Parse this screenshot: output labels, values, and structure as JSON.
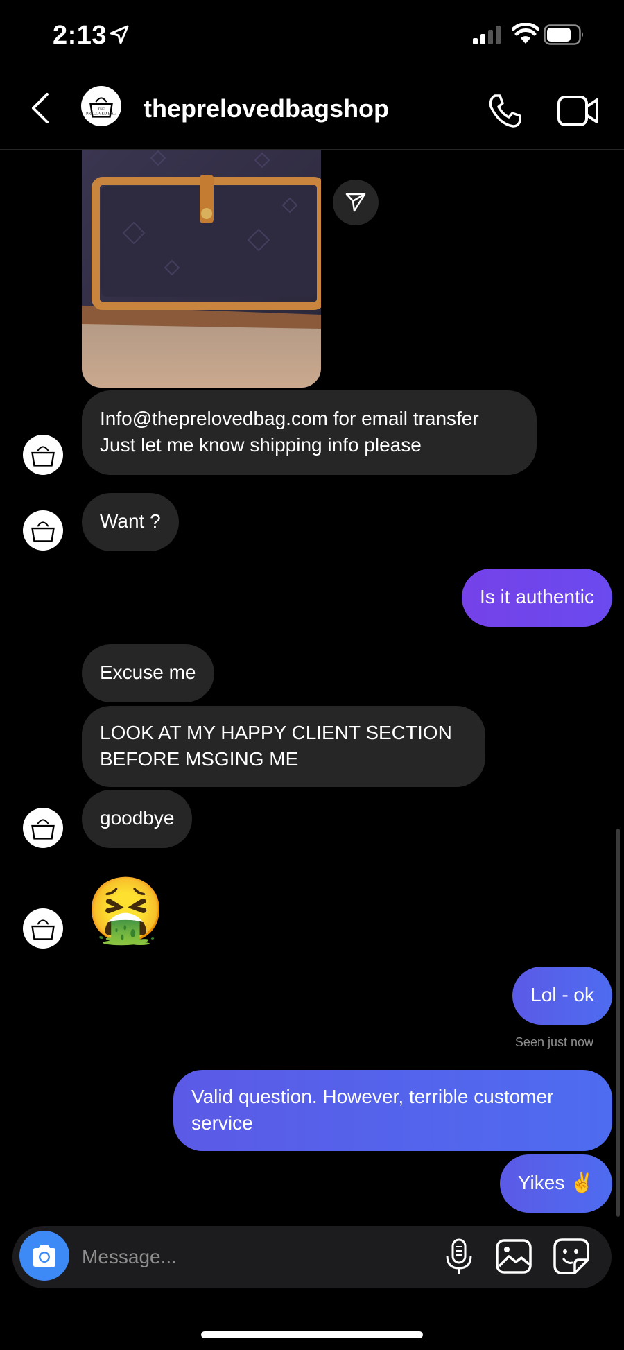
{
  "status_bar": {
    "time": "2:13"
  },
  "header": {
    "username": "theprelovedbagshop",
    "avatar_text": "THE PRELOVED BAG"
  },
  "messages": [
    {
      "from": "them",
      "type": "image"
    },
    {
      "from": "them",
      "type": "text",
      "lines": [
        "Info@theprelovedbag.com for email transfer",
        "Just let me know shipping info please"
      ]
    },
    {
      "from": "them",
      "type": "text",
      "text": "Want ?"
    },
    {
      "from": "me",
      "type": "text",
      "text": "Is it authentic"
    },
    {
      "from": "them",
      "type": "text",
      "text": "Excuse me"
    },
    {
      "from": "them",
      "type": "text",
      "lines": [
        "LOOK AT MY HAPPY CLIENT SECTION",
        "BEFORE MSGING ME"
      ]
    },
    {
      "from": "them",
      "type": "text",
      "text": "goodbye"
    },
    {
      "from": "them",
      "type": "emoji",
      "text": "🤮"
    },
    {
      "from": "me",
      "type": "text",
      "text": "Lol - ok"
    },
    {
      "from": "me",
      "type": "text",
      "lines": [
        "Valid question. However, terrible customer",
        "service"
      ]
    },
    {
      "from": "me",
      "type": "text",
      "text": "Yikes ✌️"
    }
  ],
  "seen_label": "Seen just now",
  "composer": {
    "placeholder": "Message..."
  },
  "colors": {
    "incoming_bubble": "#262626",
    "outgoing_bubble": "#5564eb",
    "outgoing_first": "#6f46ec",
    "camera_button": "#3d8af7"
  },
  "icons": [
    "location-arrow-icon",
    "signal-icon",
    "wifi-icon",
    "battery-icon",
    "back-chevron-icon",
    "phone-icon",
    "video-camera-icon",
    "send-share-icon",
    "camera-icon",
    "microphone-icon",
    "gallery-icon",
    "sticker-icon"
  ]
}
